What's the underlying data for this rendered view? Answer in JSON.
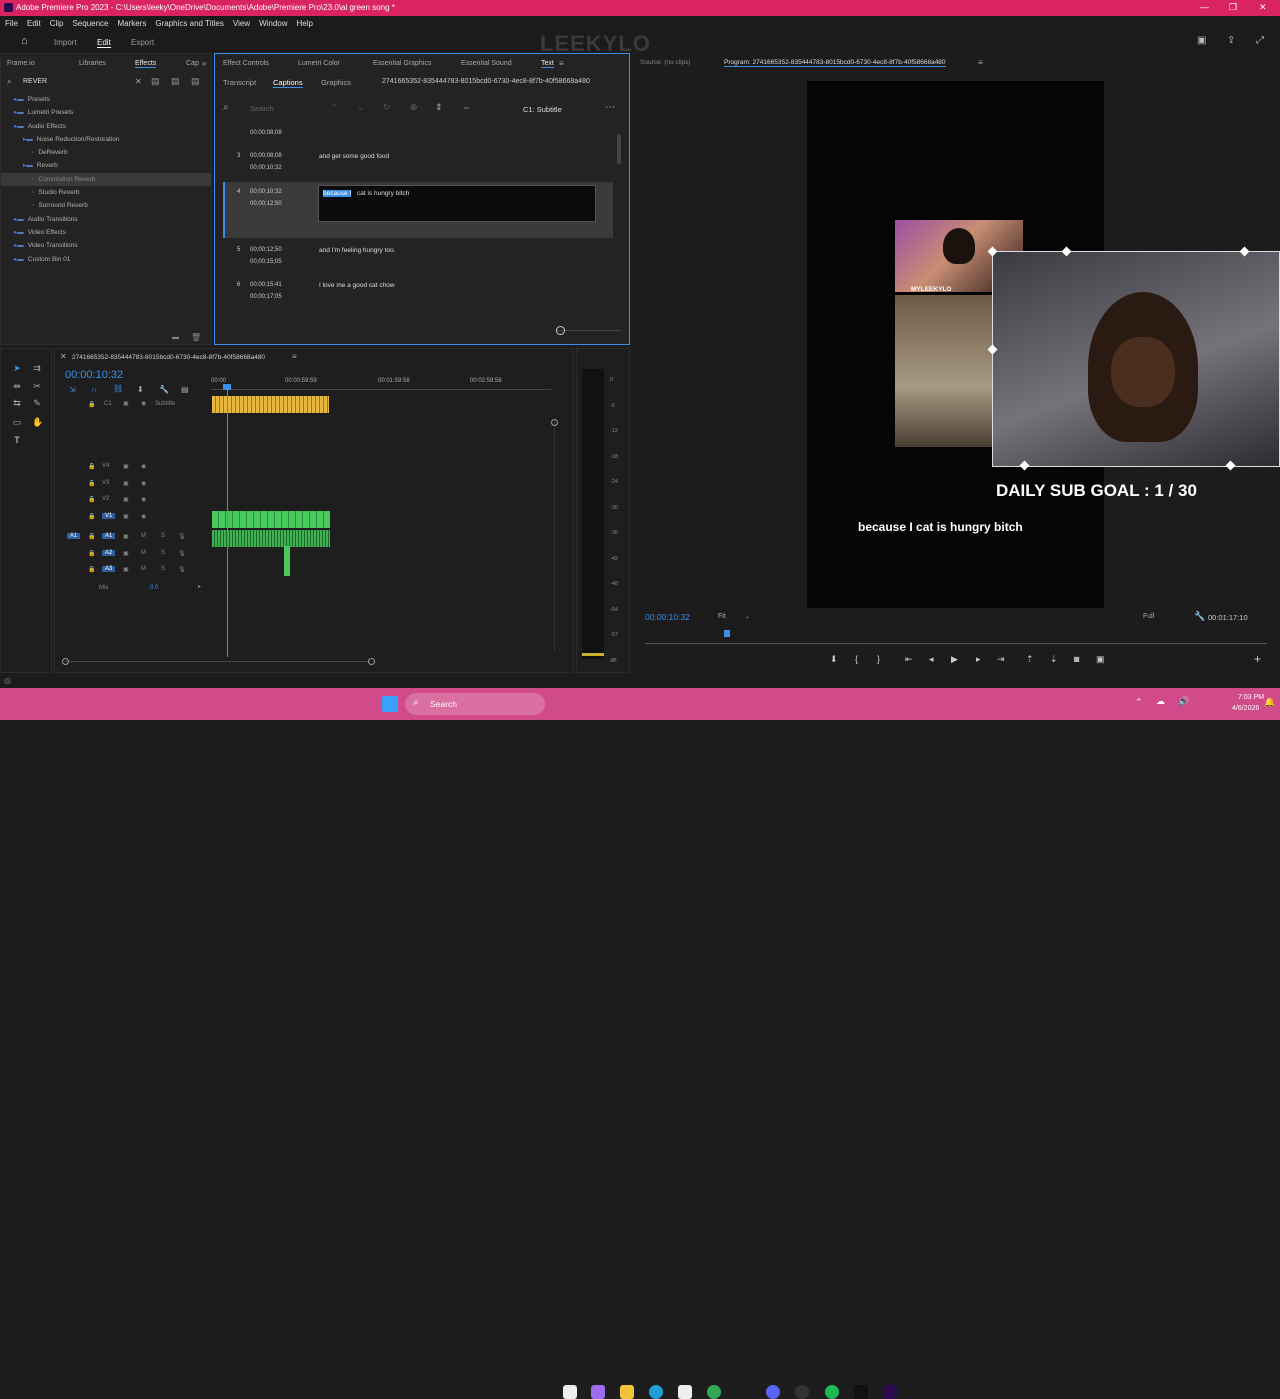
{
  "window": {
    "title": "Adobe Premiere Pro 2023 - C:\\Users\\leeky\\OneDrive\\Documents\\Adobe\\Premiere Pro\\23.0\\al green song *"
  },
  "menu": [
    "File",
    "Edit",
    "Clip",
    "Sequence",
    "Markers",
    "Graphics and Titles",
    "View",
    "Window",
    "Help"
  ],
  "workspace": {
    "tabs": [
      "Import",
      "Edit",
      "Export"
    ],
    "active": "Edit"
  },
  "watermark": "LEEKYLO",
  "project_panel": {
    "tabs": [
      "Frame.io",
      "Libraries",
      "Effects",
      "Cap"
    ],
    "search_value": "REVER",
    "tree": [
      {
        "label": "Presets",
        "indent": 1
      },
      {
        "label": "Lumetri Presets",
        "indent": 1
      },
      {
        "label": "Audio Effects",
        "indent": 1
      },
      {
        "label": "Noise Reduction/Restoration",
        "indent": 2
      },
      {
        "label": "DeReverb",
        "indent": 3
      },
      {
        "label": "Reverb",
        "indent": 2
      },
      {
        "label": "Convolution Reverb",
        "indent": 3,
        "selected": true
      },
      {
        "label": "Studio Reverb",
        "indent": 3
      },
      {
        "label": "Surround Reverb",
        "indent": 3
      },
      {
        "label": "Audio Transitions",
        "indent": 1
      },
      {
        "label": "Video Effects",
        "indent": 1
      },
      {
        "label": "Video Transitions",
        "indent": 1
      },
      {
        "label": "Custom Bin 01",
        "indent": 1
      }
    ]
  },
  "captions_panel": {
    "top_tabs": [
      "Effect Controls",
      "Lumetri Color",
      "Essential Graphics",
      "Essential Sound",
      "Text"
    ],
    "sub_tabs": [
      "Transcript",
      "Captions",
      "Graphics"
    ],
    "sequence_name": "2741665352-835444783-8015bcd0-6730-4ec8-8f7b-40f58668a480",
    "search_placeholder": "Search",
    "track_label": "C1: Subtitle",
    "top_timestamp": "00;00;08;08",
    "rows": [
      {
        "num": "3",
        "start": "00;00;08;08",
        "end": "00;00;10;32",
        "text": "and get some good food"
      },
      {
        "num": "4",
        "start": "00;00;10;32",
        "end": "00;00;12;50",
        "text_sel": "because I",
        "text_rest": " cat is hungry bitch"
      },
      {
        "num": "5",
        "start": "00;00;12;50",
        "end": "00;00;15;05",
        "text": "and I'm feeling hungry too."
      },
      {
        "num": "6",
        "start": "00;00;15;41",
        "end": "00;00;17;05",
        "text": "I love me a good cat chow"
      }
    ]
  },
  "source_monitor": {
    "label": "Source: (no clips)"
  },
  "program_monitor": {
    "label": "Program: 2741665352-835444783-8015bcd0-6730-4ec8-8f7b-40f58668a480",
    "overlay_name": "MYLEEKYLO",
    "sub_goal": "DAILY SUB GOAL : 1 / 30",
    "subtitle": "because I cat is hungry bitch",
    "timecode": "00:00:10:32",
    "fit": "Fit",
    "quality": "Full",
    "duration": "00:01:17:10"
  },
  "timeline": {
    "sequence_name": "2741665352-835444783-8015bcd0-6730-4ec8-8f7b-40f58668a480",
    "timecode": "00:00:10:32",
    "ruler": [
      "00:00",
      "00:00:59:59",
      "00:01:59:58",
      "00:02:59:58"
    ],
    "caption_track": {
      "id": "C1",
      "name": "Subtitle"
    },
    "video_tracks": [
      "V4",
      "V3",
      "V2",
      "V1"
    ],
    "audio_tracks": [
      "A1",
      "A2",
      "A3"
    ],
    "mix": {
      "label": "Mix",
      "value": "0.0"
    }
  },
  "meters": [
    "0",
    "-6",
    "-12",
    "-18",
    "-24",
    "-30",
    "-36",
    "-42",
    "-48",
    "-54",
    "-57",
    "dB"
  ],
  "taskbar": {
    "search": "Search",
    "time": "7:03 PM",
    "date": "4/6/2026"
  },
  "colors": {
    "titlebar": "#d9245f",
    "accent_blue": "#3d8fe8",
    "clip_green": "#47c95c",
    "clip_yellow": "#e8b73d"
  }
}
